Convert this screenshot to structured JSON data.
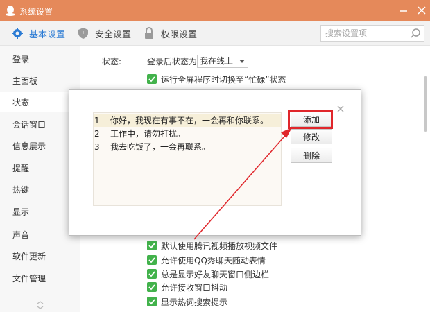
{
  "window": {
    "title": "系统设置",
    "icon": "qq-penguin-icon"
  },
  "topnav": {
    "tabs": [
      {
        "label": "基本设置",
        "icon": "gear-icon",
        "active": true
      },
      {
        "label": "安全设置",
        "icon": "shield-icon",
        "active": false
      },
      {
        "label": "权限设置",
        "icon": "lock-icon",
        "active": false
      }
    ],
    "search_placeholder": "搜索设置项",
    "search_icon": "search-icon"
  },
  "sidebar": {
    "items": [
      {
        "label": "登录"
      },
      {
        "label": "主面板"
      },
      {
        "label": "状态",
        "active": true
      },
      {
        "label": "会话窗口"
      },
      {
        "label": "信息展示"
      },
      {
        "label": "提醒"
      },
      {
        "label": "热键"
      },
      {
        "label": "显示"
      },
      {
        "label": "声音"
      },
      {
        "label": "软件更新"
      },
      {
        "label": "文件管理"
      }
    ]
  },
  "status_section": {
    "label": "状态:",
    "login_status_label": "登录后状态为:",
    "login_status_value": "我在线上",
    "fullscreen_option": "运行全屏程序时切换至“忙碌”状态"
  },
  "checkboxes_bottom": [
    "默认使用腾讯视频播放视频文件",
    "允许使用QQ秀聊天随动表情",
    "总是显示好友聊天窗口侧边栏",
    "允许接收窗口抖动",
    "显示热词搜索提示"
  ],
  "dialog": {
    "messages": [
      {
        "num": "1",
        "text": "你好，我现在有事不在，一会再和你联系。"
      },
      {
        "num": "2",
        "text": "工作中，请勿打扰。"
      },
      {
        "num": "3",
        "text": "我去吃饭了，一会再联系。"
      }
    ],
    "buttons": {
      "add": "添加",
      "edit": "修改",
      "delete": "删除"
    }
  },
  "colors": {
    "titlebar": "#e5895a",
    "accent": "#2b7bd4",
    "checkbox": "#42b24b",
    "highlight": "#e0262b"
  }
}
